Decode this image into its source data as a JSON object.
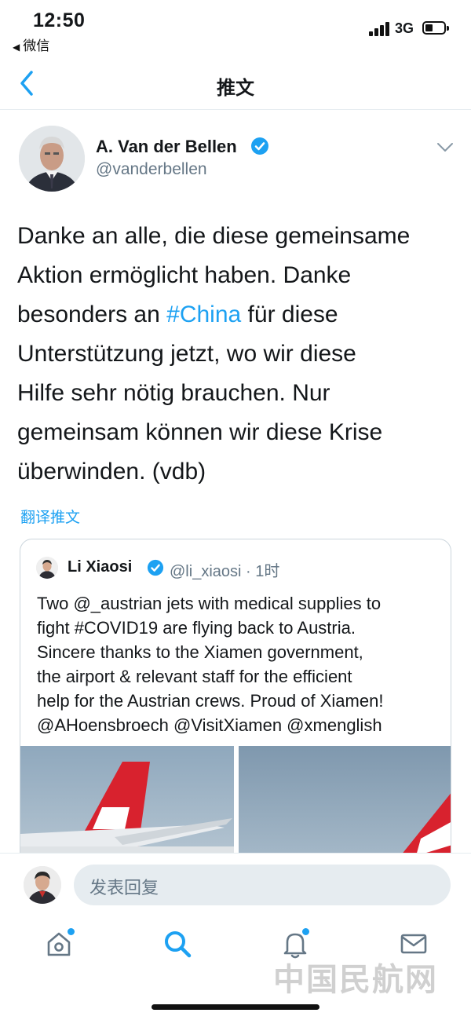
{
  "status_bar": {
    "time": "12:50",
    "back_app": "微信",
    "network": "3G"
  },
  "nav": {
    "title": "推文",
    "back_icon": "chevron-left-icon"
  },
  "tweet": {
    "author_name": "A. Van der Bellen",
    "handle": "@vanderbellen",
    "text_lines": [
      {
        "before": "Danke an alle, die diese gemeinsame",
        "hashtag": "",
        "after": ""
      },
      {
        "before": "Aktion ermöglicht haben. Danke",
        "hashtag": "",
        "after": ""
      },
      {
        "before": "besonders an ",
        "hashtag": "#China",
        "after": " für diese"
      },
      {
        "before": "Unterstützung jetzt, wo wir diese",
        "hashtag": "",
        "after": ""
      },
      {
        "before": "Hilfe sehr nötig brauchen. Nur",
        "hashtag": "",
        "after": ""
      },
      {
        "before": "gemeinsam können wir diese Krise",
        "hashtag": "",
        "after": ""
      },
      {
        "before": "überwinden. (vdb)",
        "hashtag": "",
        "after": ""
      }
    ],
    "translate_label": "翻译推文"
  },
  "quoted_tweet": {
    "author_name": "Li Xiaosi",
    "handle_time": "@li_xiaosi · 1时",
    "text_lines": [
      "Two @_austrian jets with medical supplies to",
      "fight #COVID19 are flying back to Austria.",
      "Sincere thanks to the Xiamen government,",
      "the airport & relevant staff for the efficient",
      "help for the Austrian crews. Proud of Xiamen!",
      "@AHoensbroech @VisitXiamen @xmenglish"
    ]
  },
  "reply": {
    "placeholder": "发表回复"
  },
  "tabbar": {
    "tabs": [
      "home-icon",
      "search-icon",
      "notifications-icon",
      "messages-icon"
    ]
  },
  "watermark": "中国民航网",
  "colors": {
    "accent": "#1da1f2",
    "secondary_text": "#657786",
    "livery_red": "#d8222e"
  }
}
